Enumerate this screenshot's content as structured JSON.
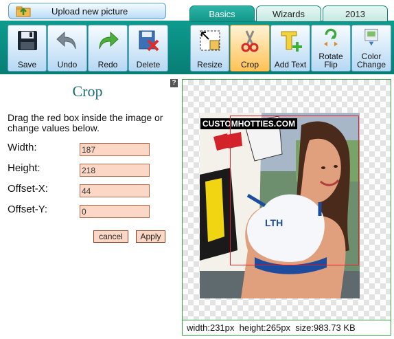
{
  "upload_label": "Upload new picture",
  "tabs": [
    {
      "label": "Basics",
      "active": true
    },
    {
      "label": "Wizards",
      "active": false
    },
    {
      "label": "2013",
      "active": false
    }
  ],
  "tools": [
    {
      "label": "Save",
      "icon": "floppy-disk-icon"
    },
    {
      "label": "Undo",
      "icon": "undo-arrow-icon"
    },
    {
      "label": "Redo",
      "icon": "redo-arrow-icon"
    },
    {
      "label": "Delete",
      "icon": "delete-icon"
    },
    {
      "label": "Resize",
      "icon": "resize-icon"
    },
    {
      "label": "Crop",
      "icon": "scissors-icon",
      "active": true
    },
    {
      "label": "Add Text",
      "icon": "add-text-icon"
    },
    {
      "label": "Rotate",
      "label2": "Flip",
      "icon": "rotate-flip-icon"
    },
    {
      "label": "Color",
      "label2": "Change",
      "icon": "color-change-icon"
    }
  ],
  "panel": {
    "help": "?",
    "title": "Crop",
    "instructions": "Drag the red box inside the image or change values below.",
    "fields": [
      {
        "label": "Width:",
        "value": "187"
      },
      {
        "label": "Height:",
        "value": "218"
      },
      {
        "label": "Offset-X:",
        "value": "44"
      },
      {
        "label": "Offset-Y:",
        "value": "0"
      }
    ],
    "cancel": "cancel",
    "apply": "Apply"
  },
  "image": {
    "watermark": "CUSTOMHOTTIES.COM"
  },
  "status": {
    "text": "width:231px  height:265px  size:983.73 KB"
  },
  "colors": {
    "toolbar": "#0d9b8e",
    "crop_border": "#e0202a",
    "field_bg": "#fcd7c5",
    "title": "#1b6c72"
  }
}
